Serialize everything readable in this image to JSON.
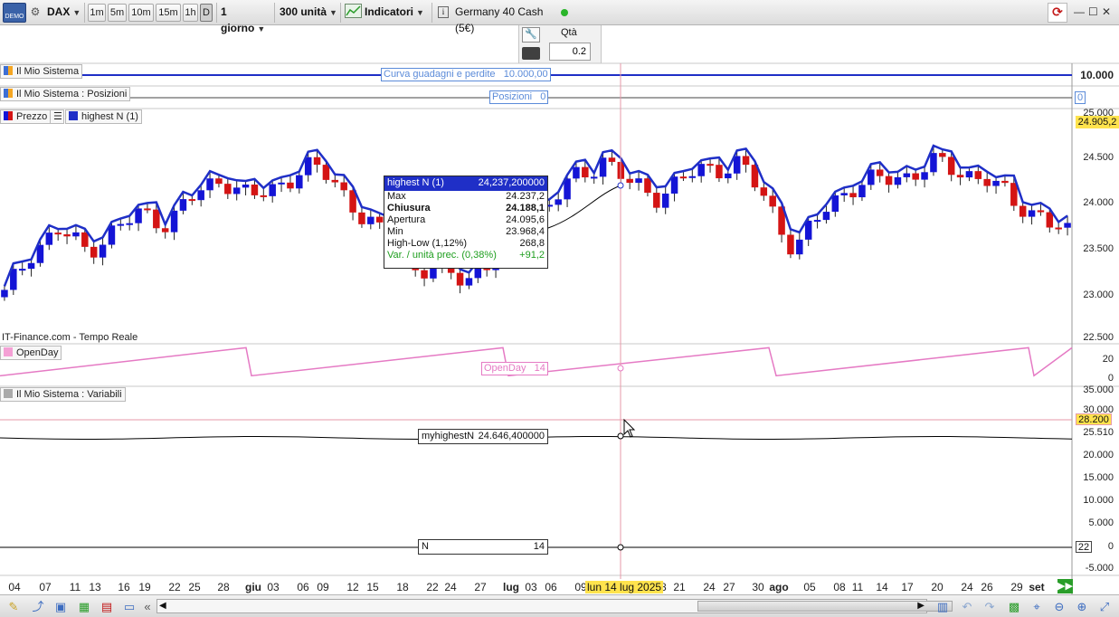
{
  "toolbar": {
    "logo_text": "DEMO",
    "symbol": "DAX",
    "timeframes": [
      "1m",
      "5m",
      "10m",
      "15m",
      "1h",
      "D"
    ],
    "period": "1 giorno",
    "units": "300 unità",
    "indicators": "Indicatori",
    "info_icon": "i",
    "instrument": "Germany 40 Cash (5€)",
    "status_color": "#2ab52a"
  },
  "order": {
    "qty_label": "Qtà",
    "qty_value": "0.2"
  },
  "panels": {
    "equity": {
      "label": "Il Mio Sistema",
      "tag": "Curva guadagni e perdite   10.000,00",
      "right": "10.000"
    },
    "positions": {
      "label": "Il Mio Sistema : Posizioni",
      "tag": "Posizioni   0",
      "right": "0"
    },
    "price": {
      "label": "Prezzo",
      "label2": "highest N (1)",
      "source": "IT-Finance.com - Tempo Reale",
      "axis": [
        "25.000",
        "24.500",
        "24.000",
        "23.500",
        "23.000",
        "22.500"
      ],
      "last_value": "24.905,2"
    },
    "openday": {
      "label": "OpenDay",
      "tag": "OpenDay   14",
      "axis": [
        "20",
        "0"
      ]
    },
    "variables": {
      "label": "Il Mio Sistema : Variabili",
      "axis": [
        "35.000",
        "30.000",
        "25.510",
        "20.000",
        "15.000",
        "10.000",
        "5.000",
        "0",
        "-5.000"
      ],
      "line_value": "28.200",
      "n_value": "22"
    }
  },
  "tooltip": {
    "title": "highest N (1)",
    "title_value": "24,237,200000",
    "rows": [
      {
        "label": "Max",
        "value": "24.237,2"
      },
      {
        "label": "Chiusura",
        "value": "24.188,1"
      },
      {
        "label": "Apertura",
        "value": "24.095,6"
      },
      {
        "label": "Min",
        "value": "23.968,4"
      },
      {
        "label": "High-Low (1,12%)",
        "value": "268,8"
      },
      {
        "label": "Var. / unità prec. (0,38%)",
        "value": "+91,2"
      }
    ]
  },
  "myhighest": {
    "label": "myhighestN",
    "value": "24.646,400000"
  },
  "n_box": {
    "label": "N",
    "value": "14"
  },
  "date_axis": {
    "labels": [
      "04",
      "07",
      "11",
      "13",
      "16",
      "19",
      "22",
      "25",
      "28",
      "giu",
      "03",
      "06",
      "09",
      "12",
      "15",
      "18",
      "22",
      "24",
      "27",
      "lug",
      "03",
      "06",
      "09",
      "18",
      "21",
      "24",
      "27",
      "30",
      "ago",
      "05",
      "08",
      "11",
      "14",
      "17",
      "20",
      "24",
      "26",
      "29",
      "set"
    ],
    "months": [
      "giu",
      "lug",
      "ago",
      "set"
    ],
    "cursor_date": "lun 14 lug 2025"
  },
  "colors": {
    "up": "#1414d6",
    "down": "#d41414",
    "highestN": "#1f2fc7",
    "openday": "#e57ac4",
    "accent": "#ffe34d"
  },
  "chart_data": [
    {
      "type": "candlestick",
      "title": "Prezzo",
      "ylim": [
        22500,
        25000
      ],
      "series": [
        {
          "name": "highest N (1)"
        }
      ],
      "x": [
        "04",
        "07",
        "11",
        "13",
        "16",
        "19",
        "22",
        "25",
        "28",
        "giu",
        "03",
        "06",
        "09",
        "12",
        "15",
        "18",
        "22",
        "24",
        "27",
        "lug",
        "03",
        "06",
        "09",
        "14",
        "18",
        "21",
        "24",
        "27",
        "30",
        "ago",
        "05",
        "08",
        "11",
        "14",
        "17",
        "20",
        "24",
        "26",
        "29",
        "set"
      ],
      "close_approx": [
        23000,
        23500,
        23700,
        23500,
        23700,
        23900,
        23800,
        24100,
        24300,
        24050,
        24200,
        24400,
        24300,
        23900,
        23600,
        23300,
        23250,
        23200,
        23400,
        23800,
        24000,
        24300,
        24500,
        24188,
        24100,
        24300,
        24400,
        24450,
        24000,
        23500,
        23900,
        24200,
        24250,
        24300,
        24450,
        24350,
        24300,
        24000,
        23900,
        23650
      ]
    },
    {
      "type": "line",
      "title": "OpenDay",
      "ylim": [
        0,
        25
      ]
    },
    {
      "type": "line",
      "title": "Il Mio Sistema : Variabili",
      "ylim": [
        -5000,
        35000
      ],
      "series": [
        {
          "name": "myhighestN"
        },
        {
          "name": "N"
        }
      ]
    }
  ]
}
